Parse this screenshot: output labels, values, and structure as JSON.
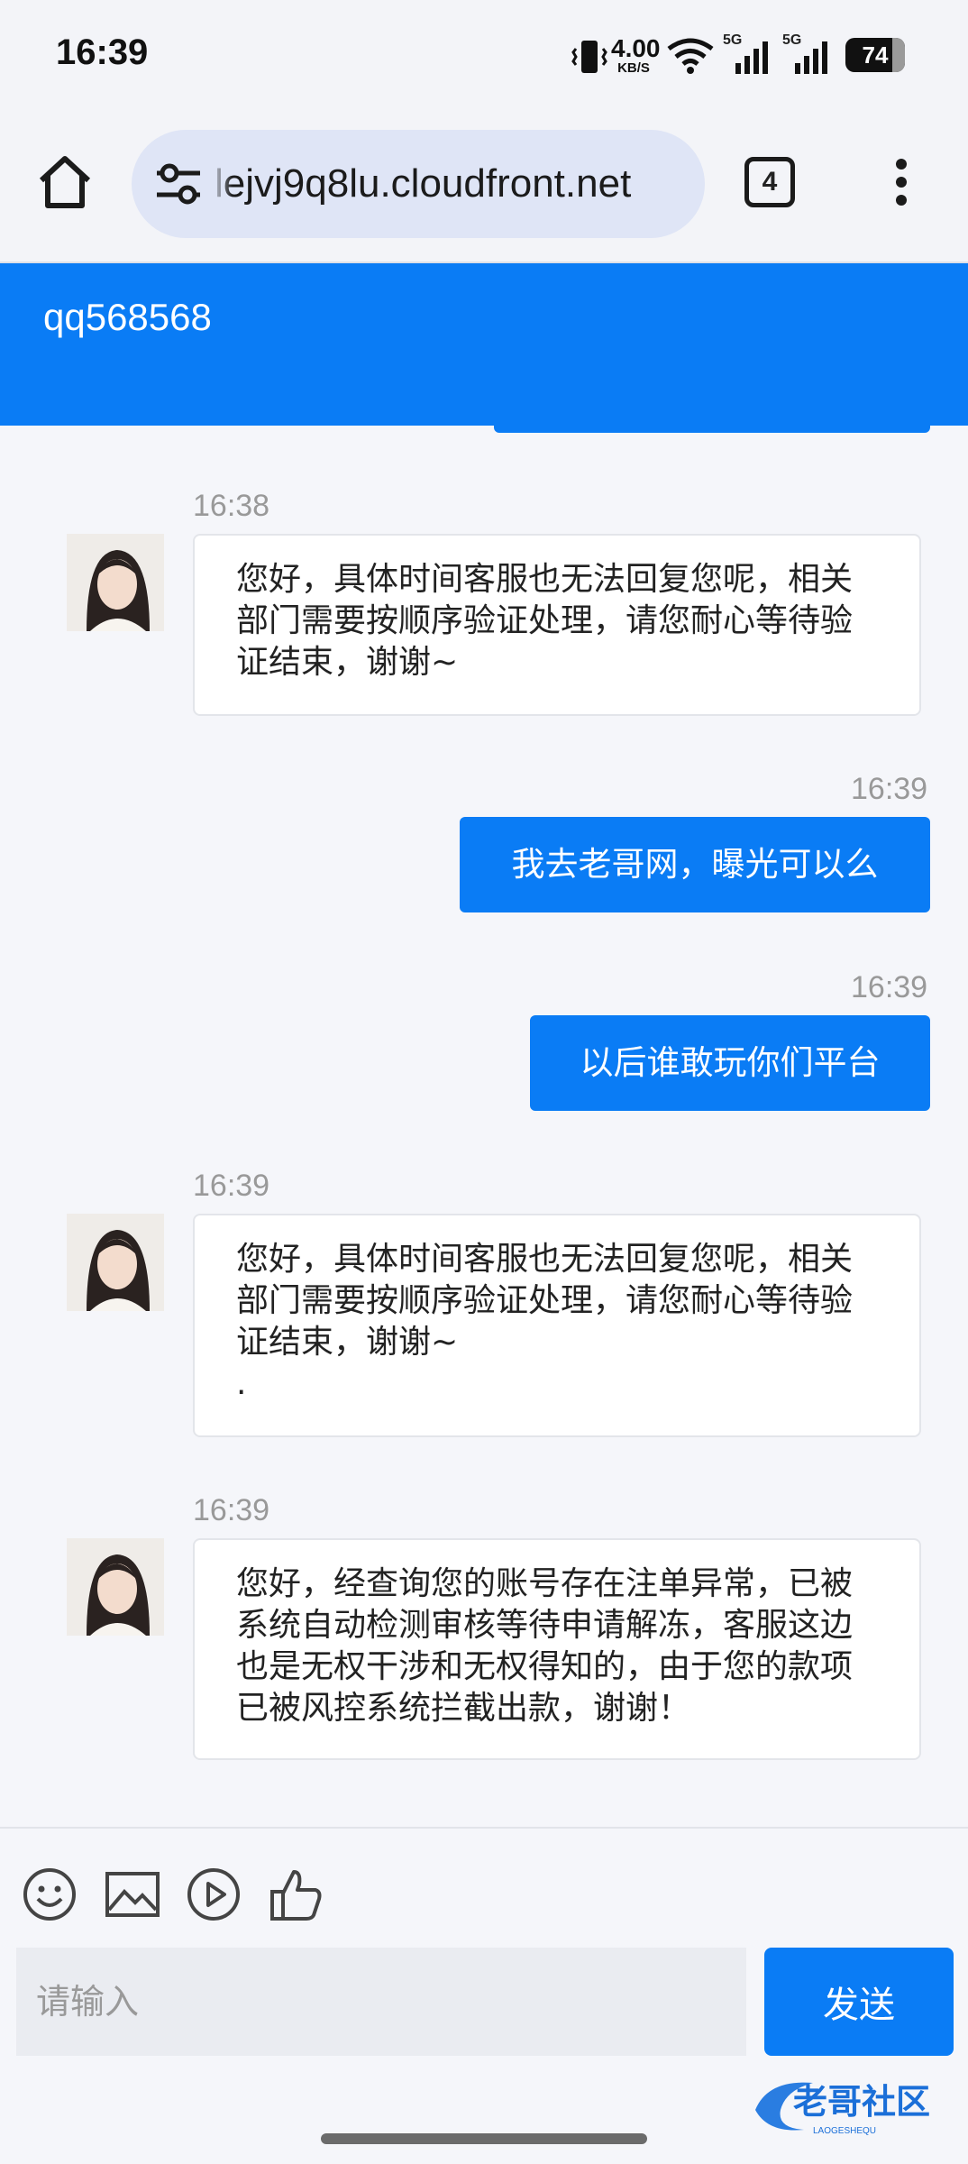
{
  "status_bar": {
    "time": "16:39",
    "net_speed_value": "4.00",
    "net_speed_unit": "KB/S",
    "sim1": "5G",
    "sim2": "5G",
    "battery": "74"
  },
  "browser": {
    "url": "lejvj9q8lu.cloudfront.net",
    "tab_count": "4"
  },
  "chat": {
    "title": "qq568568",
    "messages": [
      {
        "side": "in",
        "time": "16:38",
        "text": "您好，具体时间客服也无法回复您呢，相关部门需要按顺序验证处理，请您耐心等待验证结束，谢谢~"
      },
      {
        "side": "out",
        "time": "16:39",
        "text": "我去老哥网，曝光可以么"
      },
      {
        "side": "out",
        "time": "16:39",
        "text": "以后谁敢玩你们平台"
      },
      {
        "side": "in",
        "time": "16:39",
        "text": "您好，具体时间客服也无法回复您呢，相关部门需要按顺序验证处理，请您耐心等待验证结束，谢谢~",
        "text2": "."
      },
      {
        "side": "in",
        "time": "16:39",
        "text": "您好，经查询您的账号存在注单异常，已被系统自动检测审核等待申请解冻，客服这边也是无权干涉和无权得知的，由于您的款项已被风控系统拦截出款，谢谢！"
      }
    ]
  },
  "input": {
    "placeholder": "请输入",
    "send_label": "发送"
  },
  "watermark": {
    "text": "老哥社区",
    "sub": "LAOGESHEQU"
  },
  "colors": {
    "accent": "#0a7cf5",
    "bubble_in_bg": "#ffffff",
    "page_bg": "#f5f6fa"
  }
}
